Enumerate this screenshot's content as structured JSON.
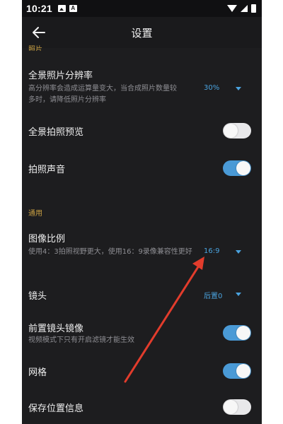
{
  "status_bar": {
    "time": "10:21",
    "notif_icons": [
      "image-icon",
      "a-icon"
    ],
    "right_icons": [
      "wifi-icon",
      "signal-icon",
      "battery-icon"
    ]
  },
  "header": {
    "title": "设置"
  },
  "sections": {
    "photo_partial_label": "照片",
    "general_label": "通用"
  },
  "settings": {
    "pano_resolution": {
      "title": "全景照片分辨率",
      "desc": "高分辨率会造成运算量变大，当合成照片数量较多时，请降低照片分辨率",
      "value": "30%"
    },
    "pano_preview": {
      "title": "全景拍照预览",
      "state": "off"
    },
    "shutter_sound": {
      "title": "拍照声音",
      "state": "on"
    },
    "aspect_ratio": {
      "title": "图像比例",
      "desc": "使用4：3拍照视野更大，使用16：9录像兼容性更好",
      "value": "16:9"
    },
    "lens": {
      "title": "镜头",
      "value": "后置0"
    },
    "front_mirror": {
      "title": "前置镜头镜像",
      "desc": "视频模式下只有开启滤镜才能生效",
      "state": "on"
    },
    "grid": {
      "title": "网格",
      "state": "on"
    },
    "save_location": {
      "title": "保存位置信息",
      "state": "off"
    }
  },
  "colors": {
    "accent": "#4a9ad6",
    "section": "#c9a043",
    "annotation": "#e23c2c"
  }
}
